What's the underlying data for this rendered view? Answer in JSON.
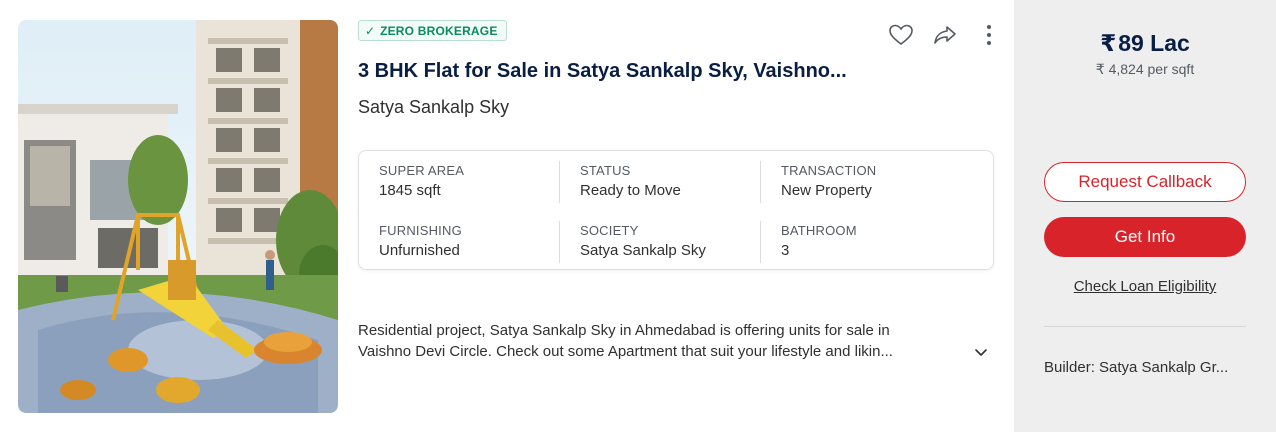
{
  "listing": {
    "badge": "ZERO BROKERAGE",
    "title": "3 BHK Flat for Sale in Satya Sankalp Sky, Vaishno...",
    "subtitle": "Satya Sankalp Sky",
    "summary": [
      {
        "label": "SUPER AREA",
        "value": "1845 sqft"
      },
      {
        "label": "STATUS",
        "value": "Ready to Move"
      },
      {
        "label": "TRANSACTION",
        "value": "New Property"
      },
      {
        "label": "FURNISHING",
        "value": "Unfurnished"
      },
      {
        "label": "SOCIETY",
        "value": "Satya Sankalp Sky"
      },
      {
        "label": "BATHROOM",
        "value": "3"
      }
    ],
    "description": {
      "line1": "Residential project, Satya Sankalp Sky in Ahmedabad is offering units for sale in",
      "line2": "Vaishno Devi Circle. Check out some Apartment that suit your lifestyle and likin..."
    }
  },
  "pricing": {
    "currency_symbol": "₹",
    "price": "89 Lac",
    "per_sqft": "4,824 per sqft"
  },
  "cta": {
    "request_callback": "Request Callback",
    "get_info": "Get Info",
    "loan_link": "Check Loan Eligibility"
  },
  "builder": "Builder: Satya Sankalp Gr...",
  "icons": {
    "badge": "check-icon",
    "actions": [
      "heart-icon",
      "share-icon",
      "more-vertical-icon"
    ],
    "expand": "chevron-down-icon"
  },
  "colors": {
    "brand_red": "#d8232a",
    "badge_green": "#0b8a5f",
    "title_navy": "#091e42",
    "aside_bg": "#eeeeee"
  }
}
